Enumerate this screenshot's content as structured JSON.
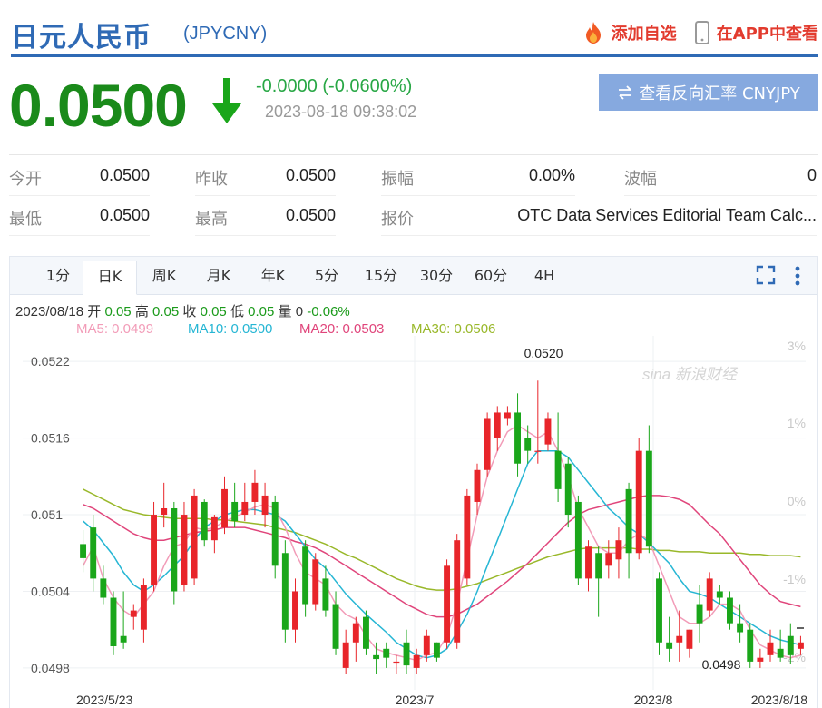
{
  "header": {
    "title": "日元人民币",
    "code": "(JPYCNY)",
    "add_watch": "添加自选",
    "app_view": "在APP中查看"
  },
  "quote": {
    "price": "0.0500",
    "change": "-0.0000 (-0.0600%)",
    "time": "2023-08-18 09:38:02",
    "reverse_button": "查看反向汇率 CNYJPY"
  },
  "stats": [
    {
      "label": "今开",
      "value": "0.0500"
    },
    {
      "label": "昨收",
      "value": "0.0500"
    },
    {
      "label": "振幅",
      "value": "0.00%"
    },
    {
      "label": "波幅",
      "value": "0"
    },
    {
      "label": "最低",
      "value": "0.0500"
    },
    {
      "label": "最高",
      "value": "0.0500"
    },
    {
      "label": "报价",
      "value": "OTC Data Services Editorial Team Calc..."
    }
  ],
  "tabs": [
    "1分",
    "日K",
    "周K",
    "月K",
    "年K",
    "5分",
    "15分",
    "30分",
    "60分",
    "4H"
  ],
  "active_tab": "日K",
  "info": {
    "date": "2023/08/18",
    "open_label": "开",
    "open": "0.05",
    "high_label": "高",
    "high": "0.05",
    "close_label": "收",
    "close": "0.05",
    "low_label": "低",
    "low": "0.05",
    "vol_label": "量",
    "vol": "0",
    "pct": "-0.06%"
  },
  "ma": [
    {
      "text": "MA5: 0.0499",
      "color": "#f29cb8"
    },
    {
      "text": "MA10: 0.0500",
      "color": "#26b6d4"
    },
    {
      "text": "MA20: 0.0503",
      "color": "#e0457b"
    },
    {
      "text": "MA30: 0.0506",
      "color": "#99b82a"
    }
  ],
  "watermark": "sina 新浪财经",
  "chart_data": {
    "type": "candlestick",
    "y_ticks": [
      "0.0522",
      "0.0516",
      "0.051",
      "0.0504",
      "0.0498"
    ],
    "pct_ticks": [
      "3%",
      "1%",
      "0%",
      "-1%",
      "-2%"
    ],
    "x_ticks": [
      "2023/5/23",
      "2023/7",
      "2023/8",
      "2023/8/18"
    ],
    "max_label": "0.0520",
    "min_label": "0.0498",
    "ylim": [
      0.0497,
      0.0524
    ],
    "colors": {
      "up": "#e8252a",
      "down": "#1aa61a"
    },
    "candles": [
      {
        "o": 0.05077,
        "h": 0.05088,
        "l": 0.05055,
        "c": 0.05066
      },
      {
        "o": 0.0509,
        "h": 0.051,
        "l": 0.0504,
        "c": 0.0505
      },
      {
        "o": 0.0505,
        "h": 0.0506,
        "l": 0.0503,
        "c": 0.05035
      },
      {
        "o": 0.05035,
        "h": 0.0504,
        "l": 0.0499,
        "c": 0.04997
      },
      {
        "o": 0.05005,
        "h": 0.0504,
        "l": 0.04995,
        "c": 0.05
      },
      {
        "o": 0.0502,
        "h": 0.0503,
        "l": 0.0501,
        "c": 0.05025
      },
      {
        "o": 0.0501,
        "h": 0.0505,
        "l": 0.05,
        "c": 0.05045
      },
      {
        "o": 0.05045,
        "h": 0.0511,
        "l": 0.0504,
        "c": 0.051
      },
      {
        "o": 0.051,
        "h": 0.05125,
        "l": 0.0509,
        "c": 0.05105
      },
      {
        "o": 0.05105,
        "h": 0.0511,
        "l": 0.0503,
        "c": 0.0504
      },
      {
        "o": 0.05045,
        "h": 0.0511,
        "l": 0.0504,
        "c": 0.051
      },
      {
        "o": 0.0505,
        "h": 0.0512,
        "l": 0.05045,
        "c": 0.05115
      },
      {
        "o": 0.0511,
        "h": 0.05112,
        "l": 0.05075,
        "c": 0.0508
      },
      {
        "o": 0.0508,
        "h": 0.051,
        "l": 0.0507,
        "c": 0.05098
      },
      {
        "o": 0.0509,
        "h": 0.0513,
        "l": 0.05085,
        "c": 0.0512
      },
      {
        "o": 0.0511,
        "h": 0.05125,
        "l": 0.0509,
        "c": 0.05095
      },
      {
        "o": 0.051,
        "h": 0.05125,
        "l": 0.05095,
        "c": 0.0511
      },
      {
        "o": 0.0511,
        "h": 0.05135,
        "l": 0.051,
        "c": 0.05125
      },
      {
        "o": 0.051,
        "h": 0.05125,
        "l": 0.0509,
        "c": 0.05115
      },
      {
        "o": 0.0511,
        "h": 0.05115,
        "l": 0.0505,
        "c": 0.0506
      },
      {
        "o": 0.0507,
        "h": 0.0508,
        "l": 0.05,
        "c": 0.0501
      },
      {
        "o": 0.0501,
        "h": 0.0505,
        "l": 0.05,
        "c": 0.0504
      },
      {
        "o": 0.05075,
        "h": 0.0508,
        "l": 0.0502,
        "c": 0.0503
      },
      {
        "o": 0.0503,
        "h": 0.0507,
        "l": 0.05025,
        "c": 0.05065
      },
      {
        "o": 0.0505,
        "h": 0.0506,
        "l": 0.0502,
        "c": 0.05025
      },
      {
        "o": 0.0503,
        "h": 0.0504,
        "l": 0.0499,
        "c": 0.04995
      },
      {
        "o": 0.0498,
        "h": 0.0501,
        "l": 0.04975,
        "c": 0.05
      },
      {
        "o": 0.05,
        "h": 0.0502,
        "l": 0.04985,
        "c": 0.05015
      },
      {
        "o": 0.0502,
        "h": 0.05025,
        "l": 0.0499,
        "c": 0.04995
      },
      {
        "o": 0.0499,
        "h": 0.05,
        "l": 0.04975,
        "c": 0.04987
      },
      {
        "o": 0.04995,
        "h": 0.05,
        "l": 0.0498,
        "c": 0.04988
      },
      {
        "o": 0.04985,
        "h": 0.0499,
        "l": 0.04975,
        "c": 0.04985
      },
      {
        "o": 0.05,
        "h": 0.0501,
        "l": 0.04975,
        "c": 0.04982
      },
      {
        "o": 0.0498,
        "h": 0.04995,
        "l": 0.04975,
        "c": 0.0499
      },
      {
        "o": 0.0499,
        "h": 0.0501,
        "l": 0.04985,
        "c": 0.05005
      },
      {
        "o": 0.05,
        "h": 0.0499,
        "l": 0.04985,
        "c": 0.04988
      },
      {
        "o": 0.05,
        "h": 0.05065,
        "l": 0.04995,
        "c": 0.0506
      },
      {
        "o": 0.05,
        "h": 0.05085,
        "l": 0.04995,
        "c": 0.0508
      },
      {
        "o": 0.0505,
        "h": 0.0512,
        "l": 0.05045,
        "c": 0.05115
      },
      {
        "o": 0.0511,
        "h": 0.0514,
        "l": 0.051,
        "c": 0.05135
      },
      {
        "o": 0.05135,
        "h": 0.0518,
        "l": 0.0513,
        "c": 0.05175
      },
      {
        "o": 0.0516,
        "h": 0.05185,
        "l": 0.0515,
        "c": 0.0518
      },
      {
        "o": 0.05175,
        "h": 0.05185,
        "l": 0.0517,
        "c": 0.0518
      },
      {
        "o": 0.0518,
        "h": 0.05195,
        "l": 0.0513,
        "c": 0.0514
      },
      {
        "o": 0.0516,
        "h": 0.0517,
        "l": 0.0514,
        "c": 0.0515
      },
      {
        "o": 0.0515,
        "h": 0.05205,
        "l": 0.0514,
        "c": 0.0515
      },
      {
        "o": 0.05155,
        "h": 0.0518,
        "l": 0.0515,
        "c": 0.05175
      },
      {
        "o": 0.0515,
        "h": 0.0518,
        "l": 0.0511,
        "c": 0.0512
      },
      {
        "o": 0.0514,
        "h": 0.05145,
        "l": 0.0509,
        "c": 0.051
      },
      {
        "o": 0.0511,
        "h": 0.05115,
        "l": 0.05045,
        "c": 0.0505
      },
      {
        "o": 0.0505,
        "h": 0.0508,
        "l": 0.0504,
        "c": 0.05075
      },
      {
        "o": 0.0507,
        "h": 0.05075,
        "l": 0.0502,
        "c": 0.0505
      },
      {
        "o": 0.0506,
        "h": 0.0508,
        "l": 0.0505,
        "c": 0.0507
      },
      {
        "o": 0.05065,
        "h": 0.0509,
        "l": 0.0505,
        "c": 0.0508
      },
      {
        "o": 0.0512,
        "h": 0.05125,
        "l": 0.0505,
        "c": 0.0507
      },
      {
        "o": 0.0507,
        "h": 0.0516,
        "l": 0.05065,
        "c": 0.0515
      },
      {
        "o": 0.0515,
        "h": 0.0517,
        "l": 0.0507,
        "c": 0.05075
      },
      {
        "o": 0.0505,
        "h": 0.05055,
        "l": 0.0499,
        "c": 0.05
      },
      {
        "o": 0.05,
        "h": 0.0502,
        "l": 0.04985,
        "c": 0.04995
      },
      {
        "o": 0.05,
        "h": 0.05025,
        "l": 0.04985,
        "c": 0.05005
      },
      {
        "o": 0.04995,
        "h": 0.0501,
        "l": 0.04988,
        "c": 0.0501
      },
      {
        "o": 0.0503,
        "h": 0.05045,
        "l": 0.05,
        "c": 0.05015
      },
      {
        "o": 0.05025,
        "h": 0.05055,
        "l": 0.0502,
        "c": 0.0505
      },
      {
        "o": 0.0504,
        "h": 0.05045,
        "l": 0.0503,
        "c": 0.05035
      },
      {
        "o": 0.05035,
        "h": 0.0504,
        "l": 0.0501,
        "c": 0.05015
      },
      {
        "o": 0.05015,
        "h": 0.0503,
        "l": 0.05,
        "c": 0.05008
      },
      {
        "o": 0.0501,
        "h": 0.05015,
        "l": 0.0498,
        "c": 0.04985
      },
      {
        "o": 0.04985,
        "h": 0.04995,
        "l": 0.0498,
        "c": 0.04988
      },
      {
        "o": 0.0499,
        "h": 0.0501,
        "l": 0.04985,
        "c": 0.05
      },
      {
        "o": 0.04995,
        "h": 0.0501,
        "l": 0.04985,
        "c": 0.04988
      },
      {
        "o": 0.05005,
        "h": 0.05015,
        "l": 0.04983,
        "c": 0.0499
      },
      {
        "o": 0.04995,
        "h": 0.05005,
        "l": 0.0499,
        "c": 0.05
      }
    ],
    "ma_lines": {
      "MA5": [
        0.0506,
        0.05075,
        0.0505,
        0.05035,
        0.05025,
        0.0502,
        0.0503,
        0.0504,
        0.0506,
        0.05075,
        0.05078,
        0.0509,
        0.05088,
        0.0509,
        0.05095,
        0.05098,
        0.05102,
        0.05106,
        0.05108,
        0.05105,
        0.0509,
        0.0507,
        0.05055,
        0.0505,
        0.05045,
        0.0503,
        0.05022,
        0.05018,
        0.05005,
        0.04995,
        0.04992,
        0.0499,
        0.04988,
        0.04986,
        0.0499,
        0.04992,
        0.05005,
        0.0503,
        0.05065,
        0.051,
        0.0513,
        0.0515,
        0.05165,
        0.0517,
        0.05165,
        0.0516,
        0.05165,
        0.0515,
        0.0513,
        0.05105,
        0.0509,
        0.05075,
        0.0507,
        0.0507,
        0.0508,
        0.05085,
        0.0508,
        0.0506,
        0.0504,
        0.0502,
        0.05015,
        0.05015,
        0.0502,
        0.0503,
        0.0503,
        0.05025,
        0.0501,
        0.04998,
        0.04994,
        0.0499,
        0.04988,
        0.0499
      ],
      "MA10": [
        0.05095,
        0.05088,
        0.05078,
        0.05068,
        0.05055,
        0.05045,
        0.0504,
        0.05045,
        0.05052,
        0.0506,
        0.05068,
        0.0508,
        0.0509,
        0.05095,
        0.051,
        0.05102,
        0.05104,
        0.05104,
        0.05102,
        0.051,
        0.05095,
        0.05085,
        0.05075,
        0.05065,
        0.05058,
        0.05048,
        0.05038,
        0.0503,
        0.05022,
        0.05015,
        0.05008,
        0.05,
        0.04995,
        0.0499,
        0.04988,
        0.0499,
        0.04995,
        0.05008,
        0.05022,
        0.0504,
        0.0506,
        0.0508,
        0.051,
        0.0512,
        0.0514,
        0.0515,
        0.0515,
        0.0515,
        0.05145,
        0.05135,
        0.05125,
        0.05115,
        0.05105,
        0.05098,
        0.0509,
        0.05085,
        0.05078,
        0.0507,
        0.05062,
        0.0505,
        0.0504,
        0.05038,
        0.05035,
        0.0503,
        0.05025,
        0.0502,
        0.05015,
        0.0501,
        0.05005,
        0.05002,
        0.05,
        0.04998
      ],
      "MA20": [
        0.05108,
        0.05105,
        0.051,
        0.05095,
        0.0509,
        0.05085,
        0.05082,
        0.0508,
        0.0508,
        0.05082,
        0.05084,
        0.05086,
        0.05087,
        0.05088,
        0.0509,
        0.0509,
        0.0509,
        0.05088,
        0.05086,
        0.05084,
        0.05082,
        0.05079,
        0.05077,
        0.05074,
        0.0507,
        0.05065,
        0.0506,
        0.05055,
        0.0505,
        0.05045,
        0.0504,
        0.05035,
        0.0503,
        0.05026,
        0.05022,
        0.0502,
        0.0502,
        0.05022,
        0.05026,
        0.0503,
        0.05036,
        0.05042,
        0.05048,
        0.05055,
        0.05062,
        0.0507,
        0.05078,
        0.05086,
        0.05094,
        0.051,
        0.05104,
        0.05106,
        0.05108,
        0.0511,
        0.05112,
        0.05114,
        0.05115,
        0.05115,
        0.05114,
        0.05112,
        0.05108,
        0.051,
        0.05092,
        0.05085,
        0.05075,
        0.05065,
        0.05055,
        0.05045,
        0.05038,
        0.05032,
        0.0503,
        0.05028
      ],
      "MA30": [
        0.0512,
        0.05116,
        0.05112,
        0.05108,
        0.05104,
        0.05102,
        0.051,
        0.05099,
        0.05098,
        0.05097,
        0.05097,
        0.05097,
        0.05097,
        0.05096,
        0.05096,
        0.05095,
        0.05094,
        0.05093,
        0.05092,
        0.0509,
        0.05088,
        0.05086,
        0.05083,
        0.0508,
        0.05077,
        0.05073,
        0.05069,
        0.05066,
        0.05062,
        0.05058,
        0.05054,
        0.0505,
        0.05047,
        0.05044,
        0.05042,
        0.05041,
        0.05041,
        0.05042,
        0.05044,
        0.05046,
        0.05049,
        0.05052,
        0.05055,
        0.05058,
        0.05061,
        0.05064,
        0.05067,
        0.05069,
        0.05071,
        0.05073,
        0.05074,
        0.05074,
        0.05074,
        0.05074,
        0.05074,
        0.05073,
        0.05073,
        0.05072,
        0.05072,
        0.05071,
        0.05071,
        0.05071,
        0.0507,
        0.0507,
        0.0507,
        0.0507,
        0.05069,
        0.05069,
        0.05068,
        0.05068,
        0.05068,
        0.05067
      ]
    }
  }
}
